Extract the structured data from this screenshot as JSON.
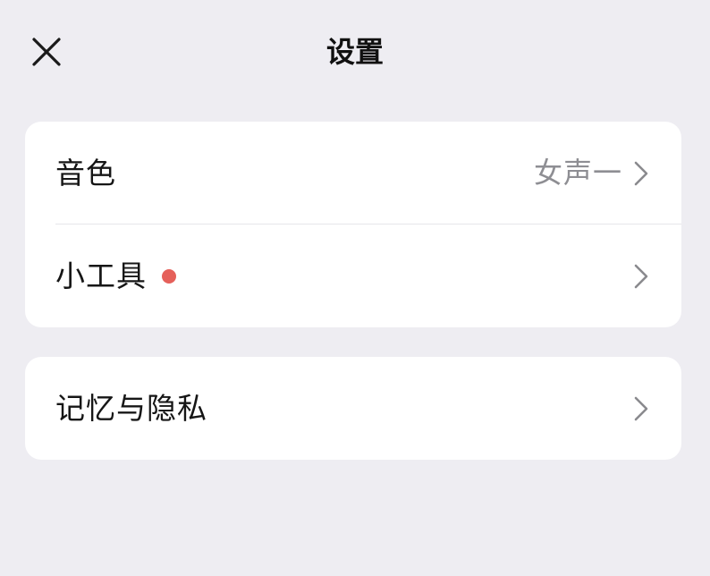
{
  "header": {
    "title": "设置",
    "close_icon": "close-icon"
  },
  "settings_group_1": {
    "items": [
      {
        "label": "音色",
        "value": "女声一",
        "icon": "chevron-right-icon"
      },
      {
        "label": "小工具",
        "value": "",
        "badge": "red-dot",
        "icon": "chevron-right-icon"
      }
    ]
  },
  "settings_group_2": {
    "items": [
      {
        "label": "记忆与隐私",
        "value": "",
        "icon": "chevron-right-icon"
      }
    ]
  },
  "colors": {
    "background": "#EEEDF2",
    "card": "#FFFFFF",
    "badge_red": "#E5605A",
    "secondary_text": "#8E8E93"
  }
}
